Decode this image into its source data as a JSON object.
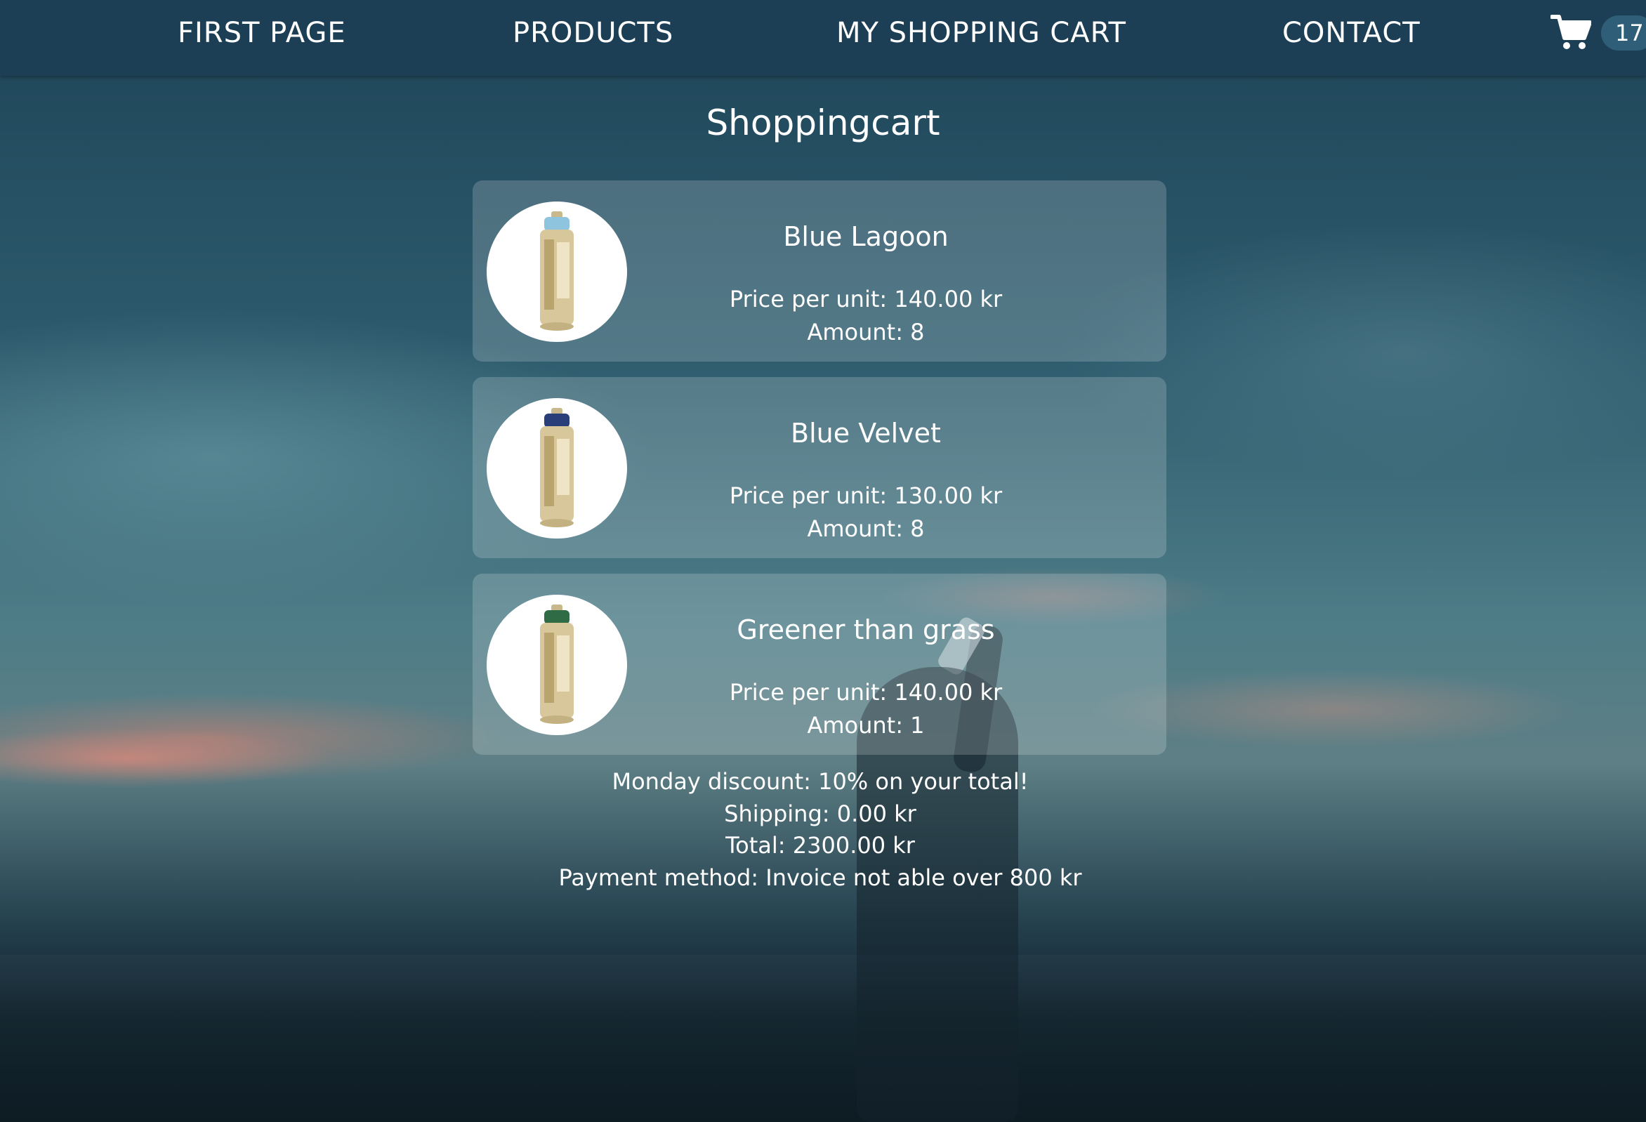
{
  "nav": {
    "links": [
      "FIRST PAGE",
      "PRODUCTS",
      "MY SHOPPING CART",
      "CONTACT"
    ],
    "cart_icon": "shopping-cart-icon",
    "cart_count": "17"
  },
  "page": {
    "title": "Shoppingcart"
  },
  "items": [
    {
      "name": "Blue Lagoon",
      "price": "Price per unit: 140.00 kr",
      "amount": "Amount: 8",
      "cap_color": "#8fc4de"
    },
    {
      "name": "Blue Velvet",
      "price": "Price per unit: 130.00 kr",
      "amount": "Amount: 8",
      "cap_color": "#2a3f7a"
    },
    {
      "name": "Greener than grass",
      "price": "Price per unit: 140.00 kr",
      "amount": "Amount: 1",
      "cap_color": "#2f6b45"
    }
  ],
  "summary": {
    "discount": "Monday discount: 10% on your total!",
    "shipping": "Shipping: 0.00 kr",
    "total": "Total: 2300.00 kr",
    "payment": "Payment method: Invoice not able over 800 kr"
  },
  "colors": {
    "nav_bg": "#1d3f55",
    "badge_bg": "#2f5f78",
    "can_gold": "#d8c79a"
  }
}
